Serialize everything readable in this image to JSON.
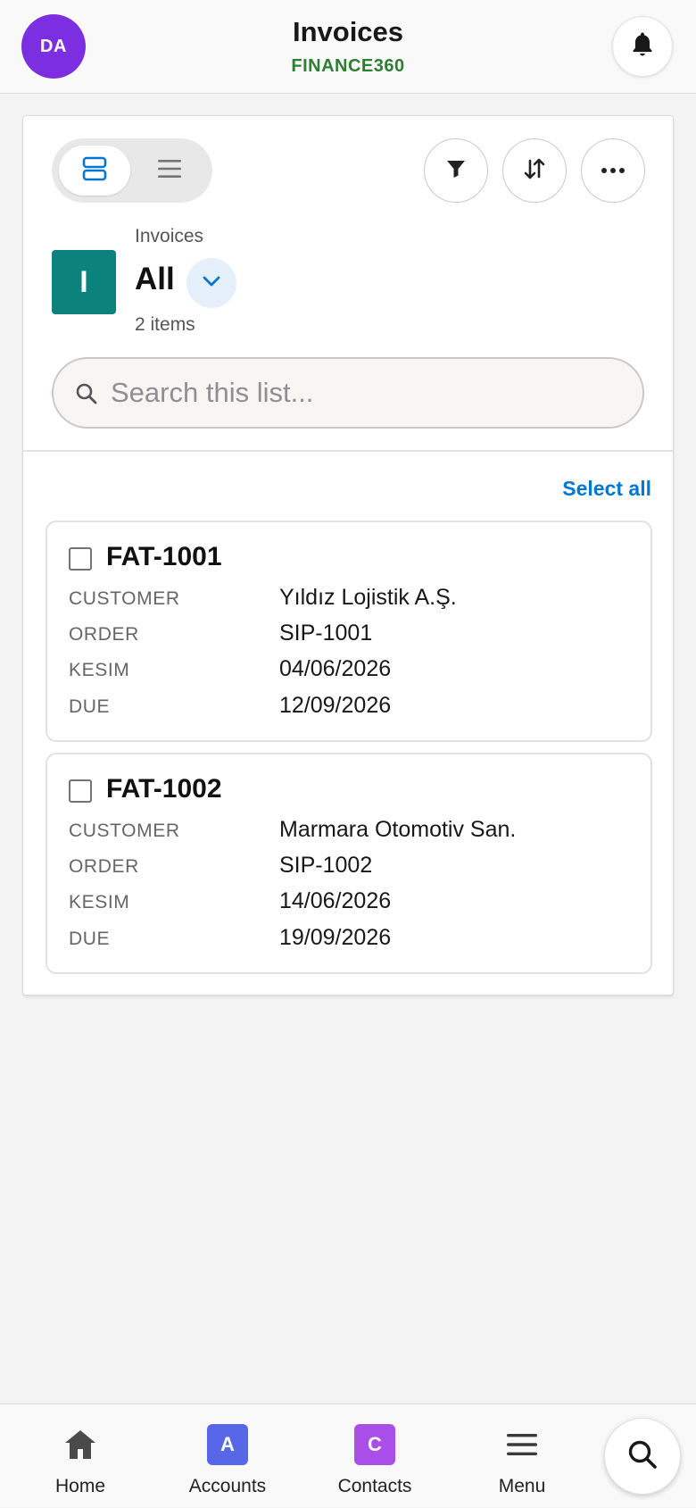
{
  "header": {
    "avatar_initials": "DA",
    "title": "Invoices",
    "subtitle": "FINANCE360",
    "avatar_color": "#7b2fe0",
    "subtitle_color": "#2e7d32",
    "notification_icon": "bell-icon"
  },
  "toolbar": {
    "view_options": [
      {
        "icon": "card-view-icon",
        "active": true
      },
      {
        "icon": "list-view-icon",
        "active": false
      }
    ],
    "actions": [
      {
        "icon": "filter-icon"
      },
      {
        "icon": "sort-icon"
      },
      {
        "icon": "more-icon"
      }
    ]
  },
  "list_header": {
    "object_icon_letter": "I",
    "object_icon_color": "#0b827c",
    "object_label": "Invoices",
    "list_name": "All",
    "item_count": "2 items"
  },
  "search": {
    "placeholder": "Search this list...",
    "value": ""
  },
  "select_all_label": "Select all",
  "records": [
    {
      "title": "FAT-1001",
      "fields": [
        {
          "label": "CUSTOMER",
          "value": "Yıldız Lojistik A.Ş."
        },
        {
          "label": "ORDER",
          "value": "SIP-1001"
        },
        {
          "label": "KESIM",
          "value": "04/06/2026"
        },
        {
          "label": "DUE",
          "value": "12/09/2026"
        }
      ]
    },
    {
      "title": "FAT-1002",
      "fields": [
        {
          "label": "CUSTOMER",
          "value": "Marmara Otomotiv San."
        },
        {
          "label": "ORDER",
          "value": "SIP-1002"
        },
        {
          "label": "KESIM",
          "value": "14/06/2026"
        },
        {
          "label": "DUE",
          "value": "19/09/2026"
        }
      ]
    }
  ],
  "bottom_nav": {
    "items": [
      {
        "label": "Home",
        "icon": "home-icon"
      },
      {
        "label": "Accounts",
        "icon_letter": "A",
        "color": "#5867e8"
      },
      {
        "label": "Contacts",
        "icon_letter": "C",
        "color": "#a94ee8"
      },
      {
        "label": "Menu",
        "icon": "hamburger-menu-icon"
      }
    ],
    "search_icon": "search-icon"
  },
  "accent_color": "#0176d3"
}
